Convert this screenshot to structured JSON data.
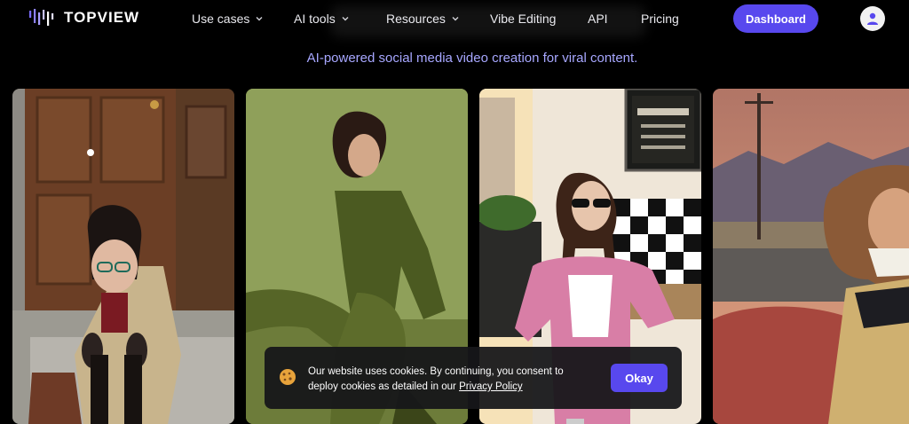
{
  "header": {
    "logo_text": "TOPVIEW",
    "nav": [
      {
        "label": "Use cases",
        "has_dropdown": true
      },
      {
        "label": "AI tools",
        "has_dropdown": true
      },
      {
        "label": "Resources",
        "has_dropdown": true
      },
      {
        "label": "Vibe Editing",
        "has_dropdown": false
      },
      {
        "label": "API",
        "has_dropdown": false
      },
      {
        "label": "Pricing",
        "has_dropdown": false
      }
    ],
    "dashboard_label": "Dashboard",
    "avatar_icon": "user-icon"
  },
  "hero": {
    "tagline": "AI-powered social media video creation for viral content."
  },
  "gallery": {
    "cards": [
      {
        "description_icon": "video-thumbnail-icon"
      },
      {
        "description_icon": "video-thumbnail-icon"
      },
      {
        "description_icon": "video-thumbnail-icon"
      },
      {
        "description_icon": "video-thumbnail-icon"
      }
    ]
  },
  "cookie_banner": {
    "text_before_link": "Our website uses cookies. By continuing, you consent to deploy cookies as detailed in our ",
    "link_text": "Privacy Policy",
    "button_label": "Okay",
    "icon": "cookie-icon"
  },
  "colors": {
    "background": "#000000",
    "accent": "#5848ee",
    "tagline": "#a7a7ff"
  }
}
